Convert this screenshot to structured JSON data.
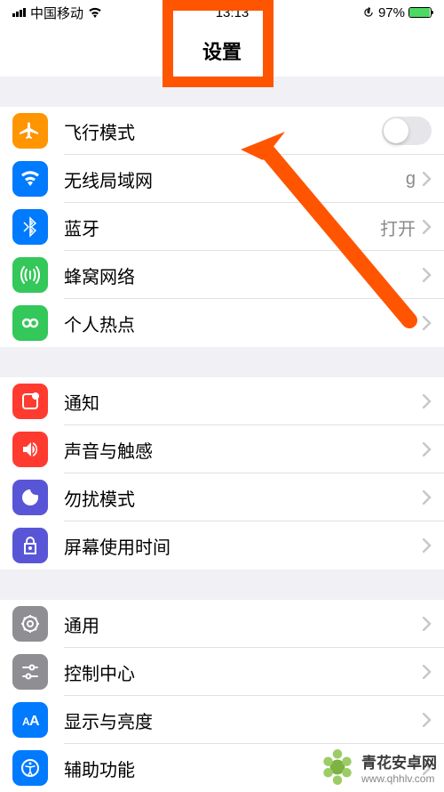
{
  "status": {
    "carrier": "中国移动",
    "time": "13:13",
    "battery": "97%"
  },
  "nav": {
    "title": "设置"
  },
  "sections": [
    {
      "rows": [
        {
          "id": "airplane",
          "label": "飞行模式",
          "icon_color": "bg-orange",
          "type": "toggle"
        },
        {
          "id": "wifi",
          "label": "无线局域网",
          "icon_color": "bg-blue",
          "type": "link",
          "value": "g"
        },
        {
          "id": "bluetooth",
          "label": "蓝牙",
          "icon_color": "bg-blue",
          "type": "link",
          "value": "打开"
        },
        {
          "id": "cellular",
          "label": "蜂窝网络",
          "icon_color": "bg-green",
          "type": "link"
        },
        {
          "id": "hotspot",
          "label": "个人热点",
          "icon_color": "bg-green",
          "type": "link"
        }
      ]
    },
    {
      "rows": [
        {
          "id": "notifications",
          "label": "通知",
          "icon_color": "bg-red",
          "type": "link"
        },
        {
          "id": "sounds",
          "label": "声音与触感",
          "icon_color": "bg-red",
          "type": "link"
        },
        {
          "id": "dnd",
          "label": "勿扰模式",
          "icon_color": "bg-purple",
          "type": "link"
        },
        {
          "id": "screentime",
          "label": "屏幕使用时间",
          "icon_color": "bg-purple",
          "type": "link"
        }
      ]
    },
    {
      "rows": [
        {
          "id": "general",
          "label": "通用",
          "icon_color": "bg-gray",
          "type": "link"
        },
        {
          "id": "control",
          "label": "控制中心",
          "icon_color": "bg-gray",
          "type": "link"
        },
        {
          "id": "display",
          "label": "显示与亮度",
          "icon_color": "bg-blue",
          "type": "link"
        },
        {
          "id": "accessibility",
          "label": "辅助功能",
          "icon_color": "bg-blue",
          "type": "link"
        }
      ]
    }
  ],
  "watermark": {
    "name": "青花安卓网",
    "url": "www.qhhlv.com"
  }
}
